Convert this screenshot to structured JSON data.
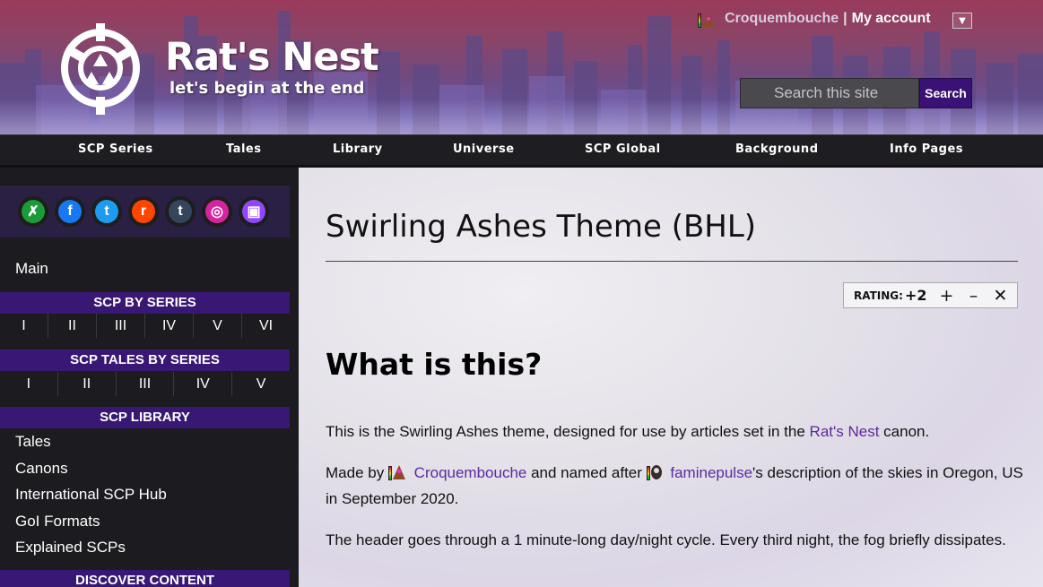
{
  "site": {
    "name": "Rat's Nest",
    "tagline": "let's begin at the end"
  },
  "account": {
    "username": "Croquembouche",
    "separator": "|",
    "my_account": "My account",
    "dropdown_icon": "triangle-down-icon"
  },
  "search": {
    "placeholder": "Search this site",
    "button": "Search"
  },
  "topnav": [
    "SCP Series",
    "Tales",
    "Library",
    "Universe",
    "SCP Global",
    "Background",
    "Info Pages"
  ],
  "social_icons": [
    {
      "name": "wikidot-icon",
      "glyph": "✗",
      "color": "#1a9b3a"
    },
    {
      "name": "facebook-icon",
      "glyph": "f",
      "color": "#1877f2"
    },
    {
      "name": "twitter-icon",
      "glyph": "t",
      "color": "#1d9bf0"
    },
    {
      "name": "reddit-icon",
      "glyph": "r",
      "color": "#ff4500"
    },
    {
      "name": "tumblr-icon",
      "glyph": "t",
      "color": "#35465c"
    },
    {
      "name": "instagram-icon",
      "glyph": "◎",
      "color": "#d6249f"
    },
    {
      "name": "twitch-icon",
      "glyph": "▣",
      "color": "#9146ff"
    }
  ],
  "sidebar": {
    "main": "Main",
    "scp_by_series": "SCP BY SERIES",
    "series": [
      "I",
      "II",
      "III",
      "IV",
      "V",
      "VI"
    ],
    "tales_by_series": "SCP TALES BY SERIES",
    "tale_series": [
      "I",
      "II",
      "III",
      "IV",
      "V"
    ],
    "library": "SCP LIBRARY",
    "library_items": [
      "Tales",
      "Canons",
      "International SCP Hub",
      "GoI Formats",
      "Explained SCPs"
    ],
    "discover": "DISCOVER CONTENT"
  },
  "page": {
    "title": "Swirling Ashes Theme (BHL)",
    "rating_label": "RATING:",
    "rating_value": "+2",
    "rate_up": "+",
    "rate_down": "–",
    "rate_cancel": "✕",
    "heading": "What is this?",
    "p1_a": "This is the Swirling Ashes theme, designed for use by articles set in the ",
    "p1_link": "Rat's Nest",
    "p1_b": " canon.",
    "p2_a": "Made by ",
    "p2_user1": "Croquembouche",
    "p2_b": " and named after ",
    "p2_user2": "faminepulse",
    "p2_c": "'s description of the skies in Oregon, US in September 2020.",
    "p3": "The header goes through a 1 minute-long day/night cycle. Every third night, the fog briefly dissipates."
  },
  "colors": {
    "accent": "#391775",
    "search_button": "#3a1275",
    "link": "#5b2aa0",
    "nav_bg": "#1e1d21",
    "sidebar_bg": "#1c1b1f"
  }
}
